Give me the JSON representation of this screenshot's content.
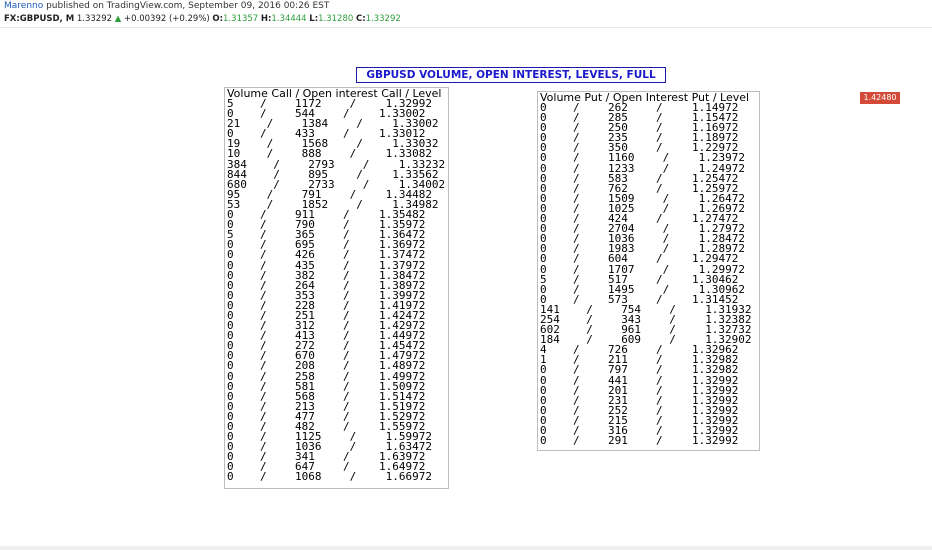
{
  "header": {
    "author": "Marenno",
    "published": " published on TradingView.com, September 09, 2016 00:26 EST",
    "symbol": "FX:GBPUSD, M",
    "price": "1.33292",
    "arrow": "▲",
    "change": "+0.00392 (+0.29%)",
    "o_key": "O:",
    "o_val": "1.31357",
    "h_key": "H:",
    "h_val": "1.34444",
    "l_key": "L:",
    "l_val": "1.31280",
    "c_key": "C:",
    "c_val": "1.33292"
  },
  "chart_title": "GBPUSD VOLUME, OPEN INTEREST, LEVELS, FULL",
  "price_badge": "1.42480",
  "call_table": {
    "header": "Volume Call / Open interest Call / Level",
    "rows": [
      [
        "5",
        "1172",
        "1.32992"
      ],
      [
        "0",
        "544",
        "1.33002"
      ],
      [
        "21",
        "1384",
        "1.33002"
      ],
      [
        "0",
        "433",
        "1.33012"
      ],
      [
        "19",
        "1568",
        "1.33032"
      ],
      [
        "10",
        "888",
        "1.33082"
      ],
      [
        "384",
        "2793",
        "1.33232"
      ],
      [
        "844",
        "895",
        "1.33562"
      ],
      [
        "680",
        "2733",
        "1.34002"
      ],
      [
        "95",
        "791",
        "1.34482"
      ],
      [
        "53",
        "1852",
        "1.34982"
      ],
      [
        "0",
        "911",
        "1.35482"
      ],
      [
        "0",
        "790",
        "1.35972"
      ],
      [
        "5",
        "365",
        "1.36472"
      ],
      [
        "0",
        "695",
        "1.36972"
      ],
      [
        "0",
        "426",
        "1.37472"
      ],
      [
        "0",
        "435",
        "1.37972"
      ],
      [
        "0",
        "382",
        "1.38472"
      ],
      [
        "0",
        "264",
        "1.38972"
      ],
      [
        "0",
        "353",
        "1.39972"
      ],
      [
        "0",
        "228",
        "1.41972"
      ],
      [
        "0",
        "251",
        "1.42472"
      ],
      [
        "0",
        "312",
        "1.42972"
      ],
      [
        "0",
        "413",
        "1.44972"
      ],
      [
        "0",
        "272",
        "1.45472"
      ],
      [
        "0",
        "670",
        "1.47972"
      ],
      [
        "0",
        "208",
        "1.48972"
      ],
      [
        "0",
        "258",
        "1.49972"
      ],
      [
        "0",
        "581",
        "1.50972"
      ],
      [
        "0",
        "568",
        "1.51472"
      ],
      [
        "0",
        "213",
        "1.51972"
      ],
      [
        "0",
        "477",
        "1.52972"
      ],
      [
        "0",
        "482",
        "1.55972"
      ],
      [
        "0",
        "1125",
        "1.59972"
      ],
      [
        "0",
        "1036",
        "1.63472"
      ],
      [
        "0",
        "341",
        "1.63972"
      ],
      [
        "0",
        "647",
        "1.64972"
      ],
      [
        "0",
        "1068",
        "1.66972"
      ]
    ]
  },
  "put_table": {
    "header": "Volume Put / Open Interest Put / Level",
    "rows": [
      [
        "0",
        "262",
        "1.14972"
      ],
      [
        "0",
        "285",
        "1.15472"
      ],
      [
        "0",
        "250",
        "1.16972"
      ],
      [
        "0",
        "235",
        "1.18972"
      ],
      [
        "0",
        "350",
        "1.22972"
      ],
      [
        "0",
        "1160",
        "1.23972"
      ],
      [
        "0",
        "1233",
        "1.24972"
      ],
      [
        "0",
        "583",
        "1.25472"
      ],
      [
        "0",
        "762",
        "1.25972"
      ],
      [
        "0",
        "1509",
        "1.26472"
      ],
      [
        "0",
        "1025",
        "1.26972"
      ],
      [
        "0",
        "424",
        "1.27472"
      ],
      [
        "0",
        "2704",
        "1.27972"
      ],
      [
        "0",
        "1036",
        "1.28472"
      ],
      [
        "0",
        "1983",
        "1.28972"
      ],
      [
        "0",
        "604",
        "1.29472"
      ],
      [
        "0",
        "1707",
        "1.29972"
      ],
      [
        "5",
        "517",
        "1.30462"
      ],
      [
        "0",
        "1495",
        "1.30962"
      ],
      [
        "0",
        "573",
        "1.31452"
      ],
      [
        "141",
        "754",
        "1.31932"
      ],
      [
        "254",
        "343",
        "1.32382"
      ],
      [
        "602",
        "961",
        "1.32732"
      ],
      [
        "184",
        "609",
        "1.32902"
      ],
      [
        "4",
        "726",
        "1.32962"
      ],
      [
        "1",
        "211",
        "1.32982"
      ],
      [
        "0",
        "797",
        "1.32982"
      ],
      [
        "0",
        "441",
        "1.32992"
      ],
      [
        "0",
        "201",
        "1.32992"
      ],
      [
        "0",
        "231",
        "1.32992"
      ],
      [
        "0",
        "252",
        "1.32992"
      ],
      [
        "0",
        "215",
        "1.32992"
      ],
      [
        "0",
        "316",
        "1.32992"
      ],
      [
        "0",
        "291",
        "1.32992"
      ]
    ]
  }
}
